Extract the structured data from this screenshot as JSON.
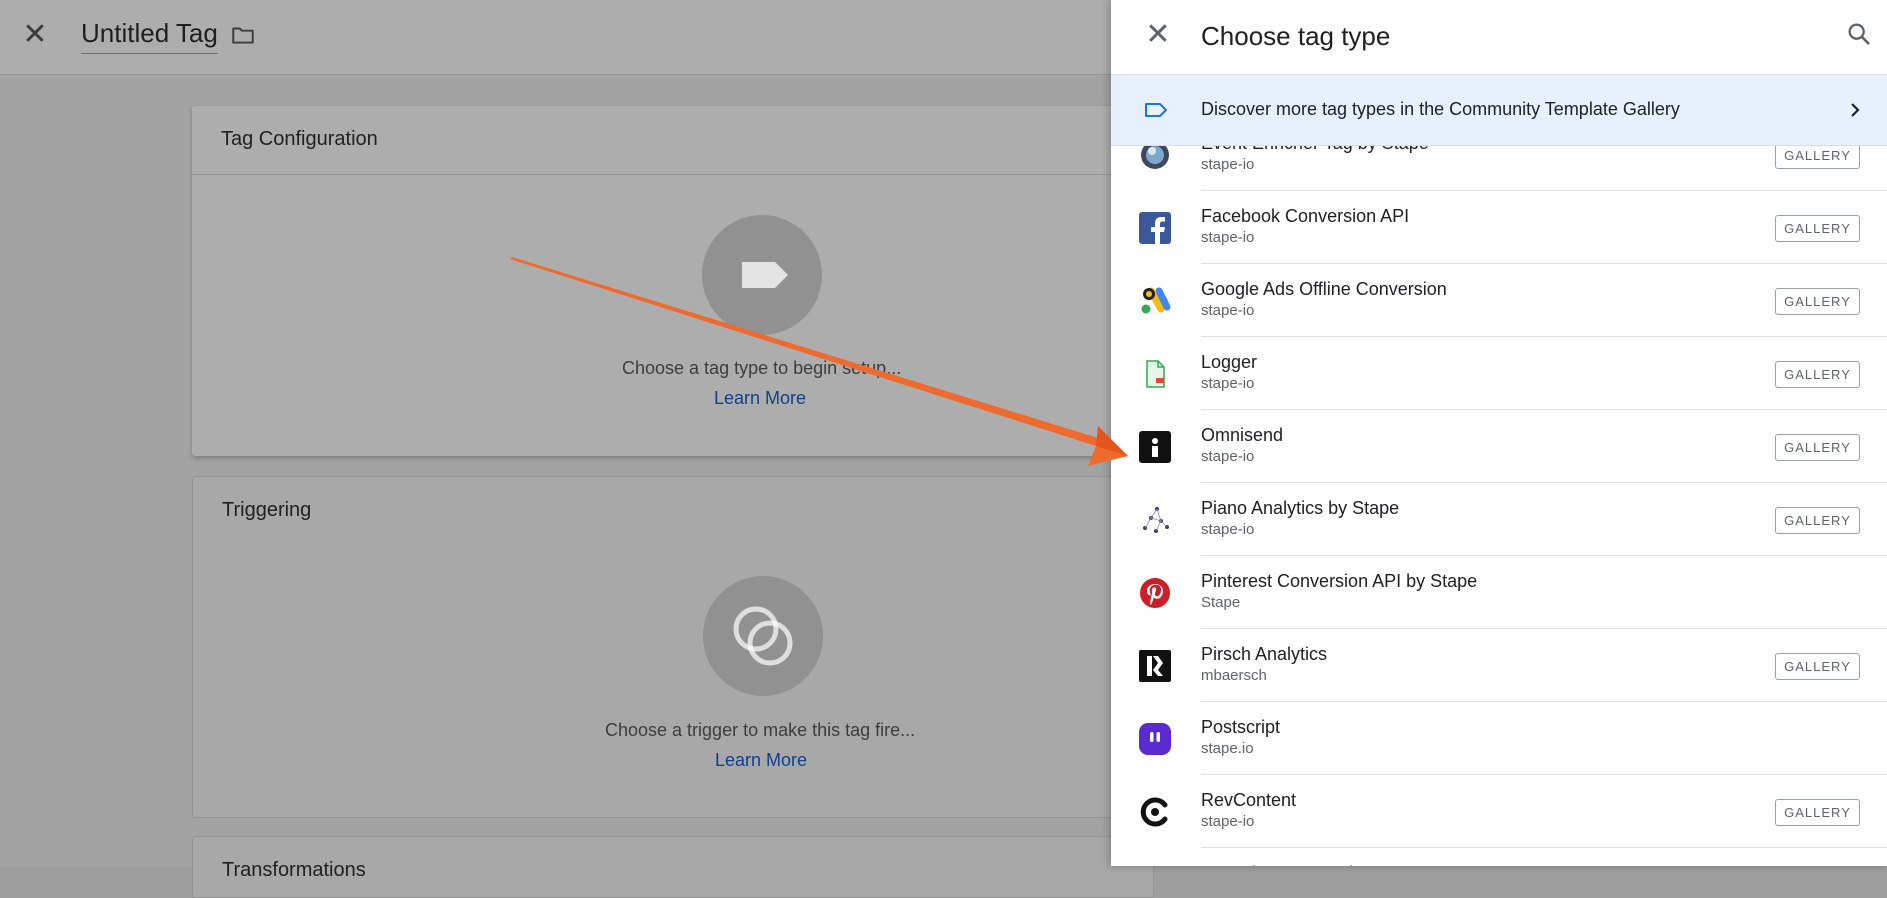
{
  "editor": {
    "title": "Untitled Tag",
    "tag_config": {
      "title": "Tag Configuration",
      "prompt": "Choose a tag type to begin setup...",
      "learn_more": "Learn More"
    },
    "triggering": {
      "title": "Triggering",
      "prompt": "Choose a trigger to make this tag fire...",
      "learn_more": "Learn More"
    },
    "next_section_title": "Transformations"
  },
  "panel": {
    "title": "Choose tag type",
    "banner": "Discover more tag types in the Community Template Gallery",
    "gallery_label": "GALLERY",
    "items": [
      {
        "name": "Event Enricher Tag by Stape",
        "sub": "stape-io",
        "gallery": true,
        "icon": "globe-icon"
      },
      {
        "name": "Facebook Conversion API",
        "sub": "stape-io",
        "gallery": true,
        "icon": "facebook-icon"
      },
      {
        "name": "Google Ads Offline Conversion",
        "sub": "stape-io",
        "gallery": true,
        "icon": "google-ads-icon"
      },
      {
        "name": "Logger",
        "sub": "stape-io",
        "gallery": true,
        "icon": "logger-doc-icon"
      },
      {
        "name": "Omnisend",
        "sub": "stape-io",
        "gallery": true,
        "icon": "omnisend-icon"
      },
      {
        "name": "Piano Analytics by Stape",
        "sub": "stape-io",
        "gallery": true,
        "icon": "piano-dots-icon"
      },
      {
        "name": "Pinterest Conversion API by Stape",
        "sub": "Stape",
        "gallery": false,
        "icon": "pinterest-icon"
      },
      {
        "name": "Pirsch Analytics",
        "sub": "mbaersch",
        "gallery": true,
        "icon": "pirsch-icon"
      },
      {
        "name": "Postscript",
        "sub": "stape.io",
        "gallery": false,
        "icon": "postscript-icon"
      },
      {
        "name": "RevContent",
        "sub": "stape-io",
        "gallery": true,
        "icon": "revcontent-icon"
      },
      {
        "name": "Snapchat Conversion API",
        "sub": "",
        "gallery": false,
        "icon": "snapchat-icon"
      }
    ]
  },
  "colors": {
    "accent": "#1a73e8",
    "arrow": "#ef6a2d",
    "facebook": "#3b5998",
    "pinterest": "#cb1f27",
    "postscript": "#5b2bd1"
  }
}
